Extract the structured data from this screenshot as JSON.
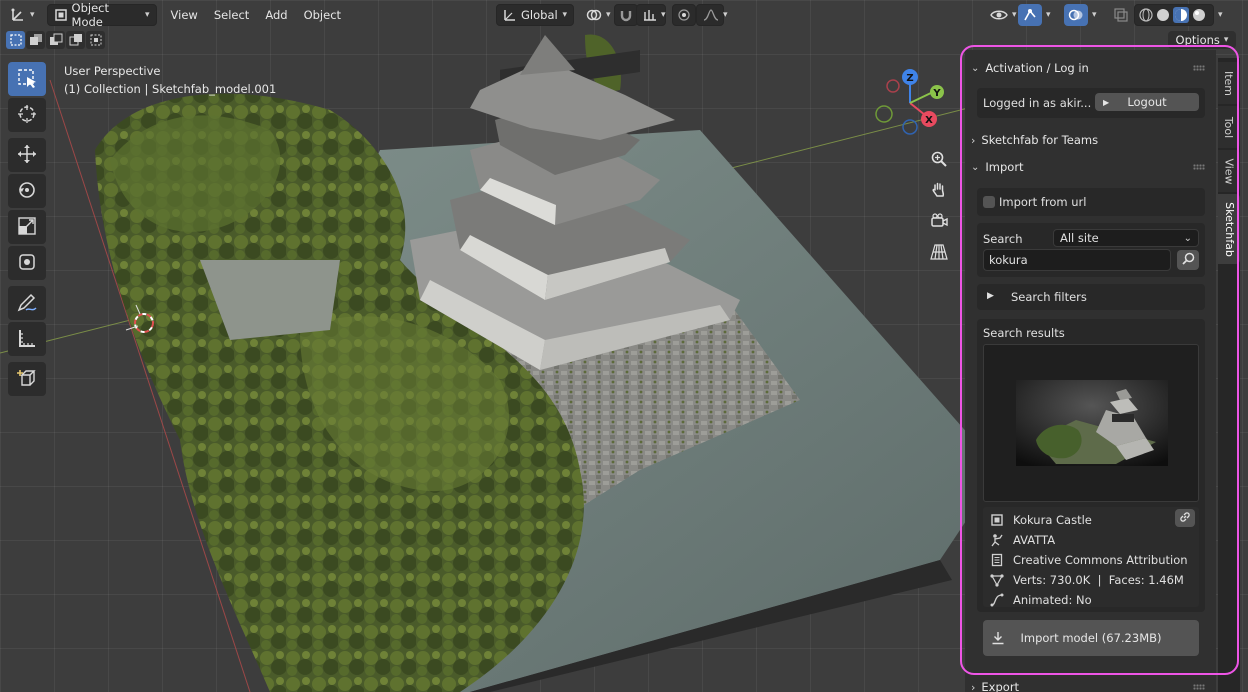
{
  "header": {
    "editor_type_icon": "axes-icon",
    "mode": "Object Mode",
    "menus": [
      "View",
      "Select",
      "Add",
      "Object"
    ],
    "orientation": "Global",
    "options_label": "Options"
  },
  "viewport": {
    "perspective": "User Perspective",
    "collection": "(1) Collection | Sketchfab_model.001",
    "gizmo": {
      "x": "X",
      "y": "Y",
      "z": "Z"
    }
  },
  "tabs": [
    "Item",
    "Tool",
    "View",
    "Sketchfab"
  ],
  "panel": {
    "activation": {
      "title": "Activation / Log in",
      "logged_in": "Logged in as akir...",
      "logout": "Logout"
    },
    "teams": {
      "title": "Sketchfab for Teams"
    },
    "import": {
      "title": "Import",
      "import_from_url": "Import from url",
      "search_label": "Search",
      "search_scope": "All site",
      "search_value": "kokura",
      "search_filters": "Search filters",
      "results_label": "Search results"
    },
    "model": {
      "name": "Kokura Castle",
      "author": "AVATTA",
      "license": "Creative Commons Attribution",
      "stats": "Verts: 730.0K  |  Faces: 1.46M",
      "animated": "Animated: No",
      "import_button": "Import model (67.23MB)"
    },
    "export": {
      "title": "Export"
    }
  },
  "colors": {
    "accent": "#4772b3",
    "highlight": "#ee55e6",
    "axis_x": "#e84a5f",
    "axis_y": "#8bc34a",
    "axis_z": "#3f83e8"
  }
}
